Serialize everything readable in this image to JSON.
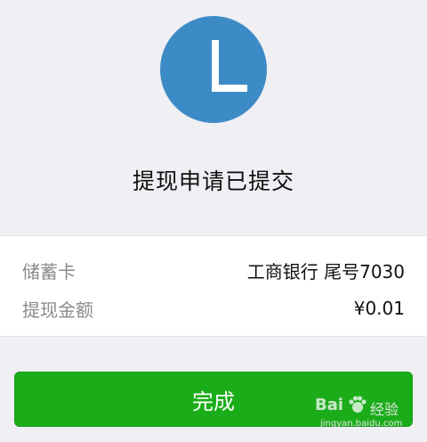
{
  "status": {
    "icon": "clock-icon",
    "icon_color": "#3d8bc6",
    "title": "提现申请已提交"
  },
  "details": {
    "rows": [
      {
        "label": "储蓄卡",
        "value": "工商银行 尾号7030"
      },
      {
        "label": "提现金额",
        "value": "¥0.01"
      }
    ]
  },
  "actions": {
    "done_label": "完成",
    "done_color": "#1aad19"
  },
  "watermark": {
    "brand": "Bai",
    "product": "经验",
    "url": "jingyan.baidu.com"
  }
}
